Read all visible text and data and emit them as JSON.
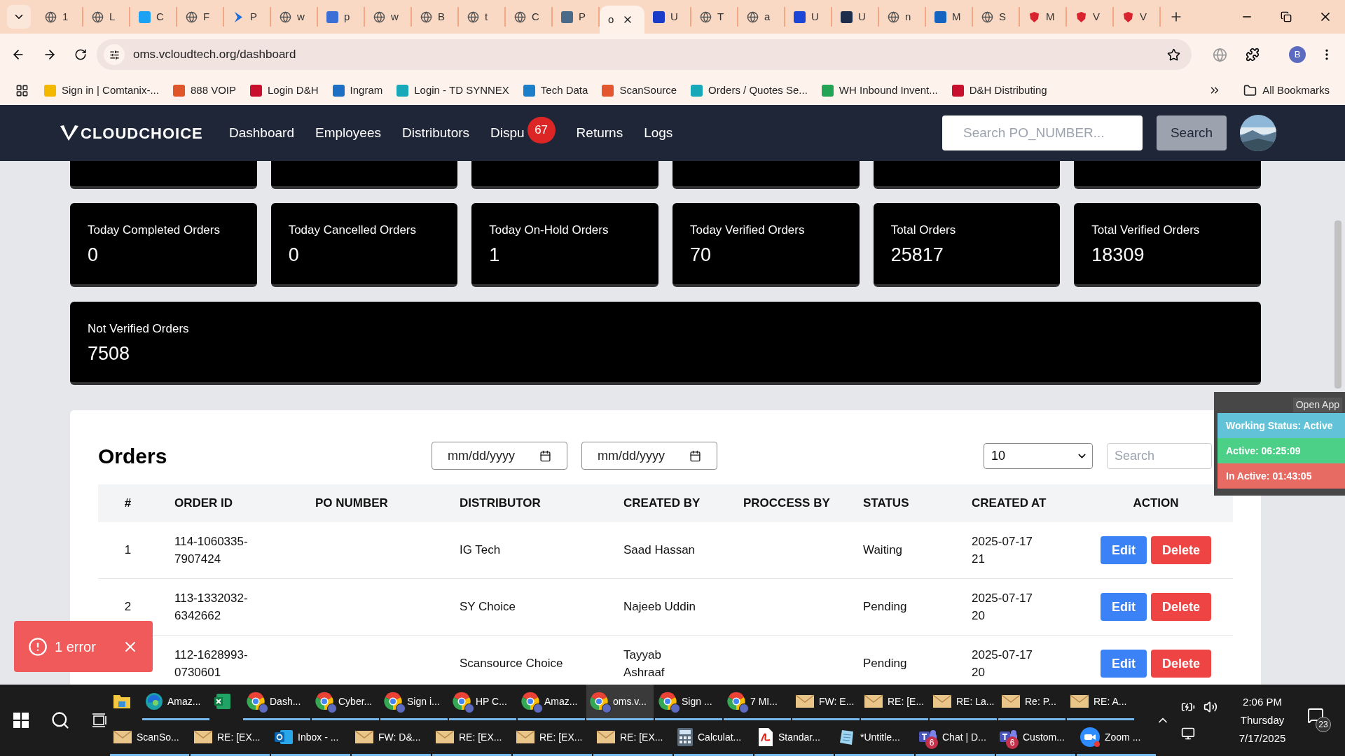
{
  "browser": {
    "tabs": [
      {
        "label": "1",
        "selected": false,
        "kind": "globe"
      },
      {
        "label": "L",
        "selected": false,
        "kind": "globe"
      },
      {
        "label": "C",
        "selected": false,
        "kind": "square",
        "color": "#1da1f2"
      },
      {
        "label": "F",
        "selected": false,
        "kind": "globe"
      },
      {
        "label": "P",
        "selected": false,
        "kind": "chevron",
        "color": "#1e6fd9"
      },
      {
        "label": "w",
        "selected": false,
        "kind": "globe"
      },
      {
        "label": "p",
        "selected": false,
        "kind": "square",
        "color": "#3b6fd6"
      },
      {
        "label": "w",
        "selected": false,
        "kind": "globe"
      },
      {
        "label": "B",
        "selected": false,
        "kind": "globe"
      },
      {
        "label": "t",
        "selected": false,
        "kind": "globe"
      },
      {
        "label": "C",
        "selected": false,
        "kind": "globe"
      },
      {
        "label": "P",
        "selected": false,
        "kind": "square",
        "color": "#4a6a8a"
      },
      {
        "label": "o",
        "selected": true,
        "kind": "plain"
      },
      {
        "label": "U",
        "selected": false,
        "kind": "square",
        "color": "#1a3cc8"
      },
      {
        "label": "T",
        "selected": false,
        "kind": "globe"
      },
      {
        "label": "a",
        "selected": false,
        "kind": "globe"
      },
      {
        "label": "U",
        "selected": false,
        "kind": "square",
        "color": "#1b46d6"
      },
      {
        "label": "U",
        "selected": false,
        "kind": "square",
        "color": "#1e2e4a"
      },
      {
        "label": "n",
        "selected": false,
        "kind": "globe"
      },
      {
        "label": "M",
        "selected": false,
        "kind": "square",
        "color": "#1565c0"
      },
      {
        "label": "S",
        "selected": false,
        "kind": "globe"
      },
      {
        "label": "M",
        "selected": false,
        "kind": "shield",
        "color": "#d9232e"
      },
      {
        "label": "V",
        "selected": false,
        "kind": "shield",
        "color": "#d9232e"
      },
      {
        "label": "V",
        "selected": false,
        "kind": "shield",
        "color": "#d9232e"
      }
    ],
    "address": "oms.vcloudtech.org/dashboard",
    "profile": "B",
    "bookmarks": [
      {
        "label": "Sign in | Comtanix-...",
        "color": "#f5b800"
      },
      {
        "label": "888 VOIP",
        "color": "#e0552a"
      },
      {
        "label": "Login D&H",
        "color": "#c8102e"
      },
      {
        "label": "Ingram",
        "color": "#1d6fc4"
      },
      {
        "label": "Login - TD SYNNEX",
        "color": "#17a9b8"
      },
      {
        "label": "Tech Data",
        "color": "#1b7fc9"
      },
      {
        "label": "ScanSource",
        "color": "#e4572e"
      },
      {
        "label": "Orders / Quotes Se...",
        "color": "#17a9b8"
      },
      {
        "label": "WH Inbound Invent...",
        "color": "#23a455"
      },
      {
        "label": "D&H Distributing",
        "color": "#c8102e"
      }
    ],
    "all_bookmarks": "All Bookmarks"
  },
  "app": {
    "logo": "CLOUDCHOICE",
    "nav": [
      {
        "label": "Dashboard"
      },
      {
        "label": "Employees"
      },
      {
        "label": "Distributors"
      },
      {
        "label": "Dispu",
        "badge": "67"
      },
      {
        "label": "Returns"
      },
      {
        "label": "Logs"
      }
    ],
    "search": {
      "placeholder": "Search PO_NUMBER..."
    },
    "search_button": "Search",
    "stats": [
      {
        "label": "Today Completed Orders",
        "value": "0"
      },
      {
        "label": "Today Cancelled Orders",
        "value": "0"
      },
      {
        "label": "Today On-Hold Orders",
        "value": "1"
      },
      {
        "label": "Today Verified Orders",
        "value": "70"
      },
      {
        "label": "Total Orders",
        "value": "25817"
      },
      {
        "label": "Total Verified Orders",
        "value": "18309"
      }
    ],
    "wide_stat": {
      "label": "Not Verified Orders",
      "value": "7508"
    },
    "orders": {
      "title": "Orders",
      "date_fields": [
        {
          "placeholder": "mm/dd/yyyy"
        },
        {
          "placeholder": "mm/dd/yyyy"
        }
      ],
      "per_page": "10",
      "search": {
        "placeholder": "Search"
      },
      "columns": [
        "#",
        "ORDER ID",
        "PO NUMBER",
        "DISTRIBUTOR",
        "CREATED BY",
        "PROCCESS BY",
        "STATUS",
        "CREATED AT",
        "ACTION"
      ],
      "rows": [
        {
          "number": "1",
          "order_id": "114-1060335-7907424",
          "distributor": "IG Tech",
          "created_by": "Saad Hassan",
          "status": "Waiting",
          "created_at": "2025-07-17 21",
          "actions": [
            "Edit",
            "Delete"
          ]
        },
        {
          "number": "2",
          "order_id": "113-1332032-6342662",
          "distributor": "SY Choice",
          "created_by": "Najeeb Uddin",
          "status": "Pending",
          "created_at": "2025-07-17 20",
          "actions": [
            "Edit",
            "Delete"
          ]
        },
        {
          "order_id": "112-1628993-0730601",
          "distributor": "Scansource Choice",
          "created_by": "Tayyab Ashraaf",
          "status": "Pending",
          "created_at": "2025-07-17 20",
          "actions": [
            "Edit",
            "Delete"
          ]
        }
      ]
    }
  },
  "status_widget": {
    "open_app": "Open App",
    "rows": [
      {
        "text": "Working Status: Active",
        "color": "#62c3d8"
      },
      {
        "text": "Active: 06:25:09",
        "color": "#4ccf87"
      },
      {
        "text": "In Active: 01:43:05",
        "color": "#e86b63"
      }
    ]
  },
  "toast": {
    "message": "1 error"
  },
  "taskbar": {
    "top_apps": [
      {
        "kind": "folder",
        "selected": false,
        "running": false
      },
      {
        "kind": "edge",
        "label": "Amaz...",
        "selected": false,
        "running": true
      },
      {
        "kind": "excel",
        "selected": false,
        "running": false
      },
      {
        "kind": "chrome",
        "label": "Dash...",
        "selected": false,
        "running": true
      },
      {
        "kind": "chrome",
        "label": "Cyber...",
        "selected": false,
        "running": true
      },
      {
        "kind": "chrome",
        "label": "Sign i...",
        "selected": false,
        "running": true
      },
      {
        "kind": "chrome",
        "label": "HP C...",
        "selected": false,
        "running": true
      },
      {
        "kind": "chrome",
        "label": "Amaz...",
        "selected": false,
        "running": true
      },
      {
        "kind": "chrome",
        "label": "oms.v...",
        "selected": true,
        "running": true
      },
      {
        "kind": "chrome",
        "label": "Sign ...",
        "selected": false,
        "running": true
      },
      {
        "kind": "chrome",
        "label": "7 MI...",
        "selected": false,
        "running": true
      },
      {
        "kind": "mail",
        "label": "FW: E...",
        "selected": false,
        "running": true
      },
      {
        "kind": "mail",
        "label": "RE: [E...",
        "selected": false,
        "running": true
      },
      {
        "kind": "mail",
        "label": "RE: La...",
        "selected": false,
        "running": true
      },
      {
        "kind": "mail",
        "label": "Re: P...",
        "selected": false,
        "running": true
      },
      {
        "kind": "mail",
        "label": "RE: A...",
        "selected": false,
        "running": true
      }
    ],
    "bottom_apps": [
      {
        "kind": "mail",
        "label": "ScanSo...",
        "selected": false,
        "running": true
      },
      {
        "kind": "mail",
        "label": "RE: [EX...",
        "selected": false,
        "running": true
      },
      {
        "kind": "outlook",
        "label": "Inbox - ...",
        "selected": false,
        "running": true
      },
      {
        "kind": "mail",
        "label": "FW: D&...",
        "selected": false,
        "running": true
      },
      {
        "kind": "mail",
        "label": "RE: [EX...",
        "selected": false,
        "running": true
      },
      {
        "kind": "mail",
        "label": "RE: [EX...",
        "selected": false,
        "running": true
      },
      {
        "kind": "mail",
        "label": "RE: [EX...",
        "selected": false,
        "running": true
      },
      {
        "kind": "calculator",
        "label": "Calculat...",
        "selected": false,
        "running": true
      },
      {
        "kind": "pdf",
        "label": "Standar...",
        "selected": false,
        "running": true
      },
      {
        "kind": "notepad",
        "label": "*Untitle...",
        "selected": false,
        "running": true
      },
      {
        "kind": "teams",
        "label": "Chat | D...",
        "badge": "6",
        "selected": false,
        "running": true
      },
      {
        "kind": "teams",
        "label": "Custom...",
        "badge": "6",
        "selected": false,
        "running": true
      },
      {
        "kind": "zoom",
        "label": "Zoom ...",
        "selected": false,
        "running": true
      }
    ],
    "tray": {
      "time": "2:06 PM",
      "day": "Thursday",
      "date": "7/17/2025",
      "notifications": "23"
    }
  }
}
